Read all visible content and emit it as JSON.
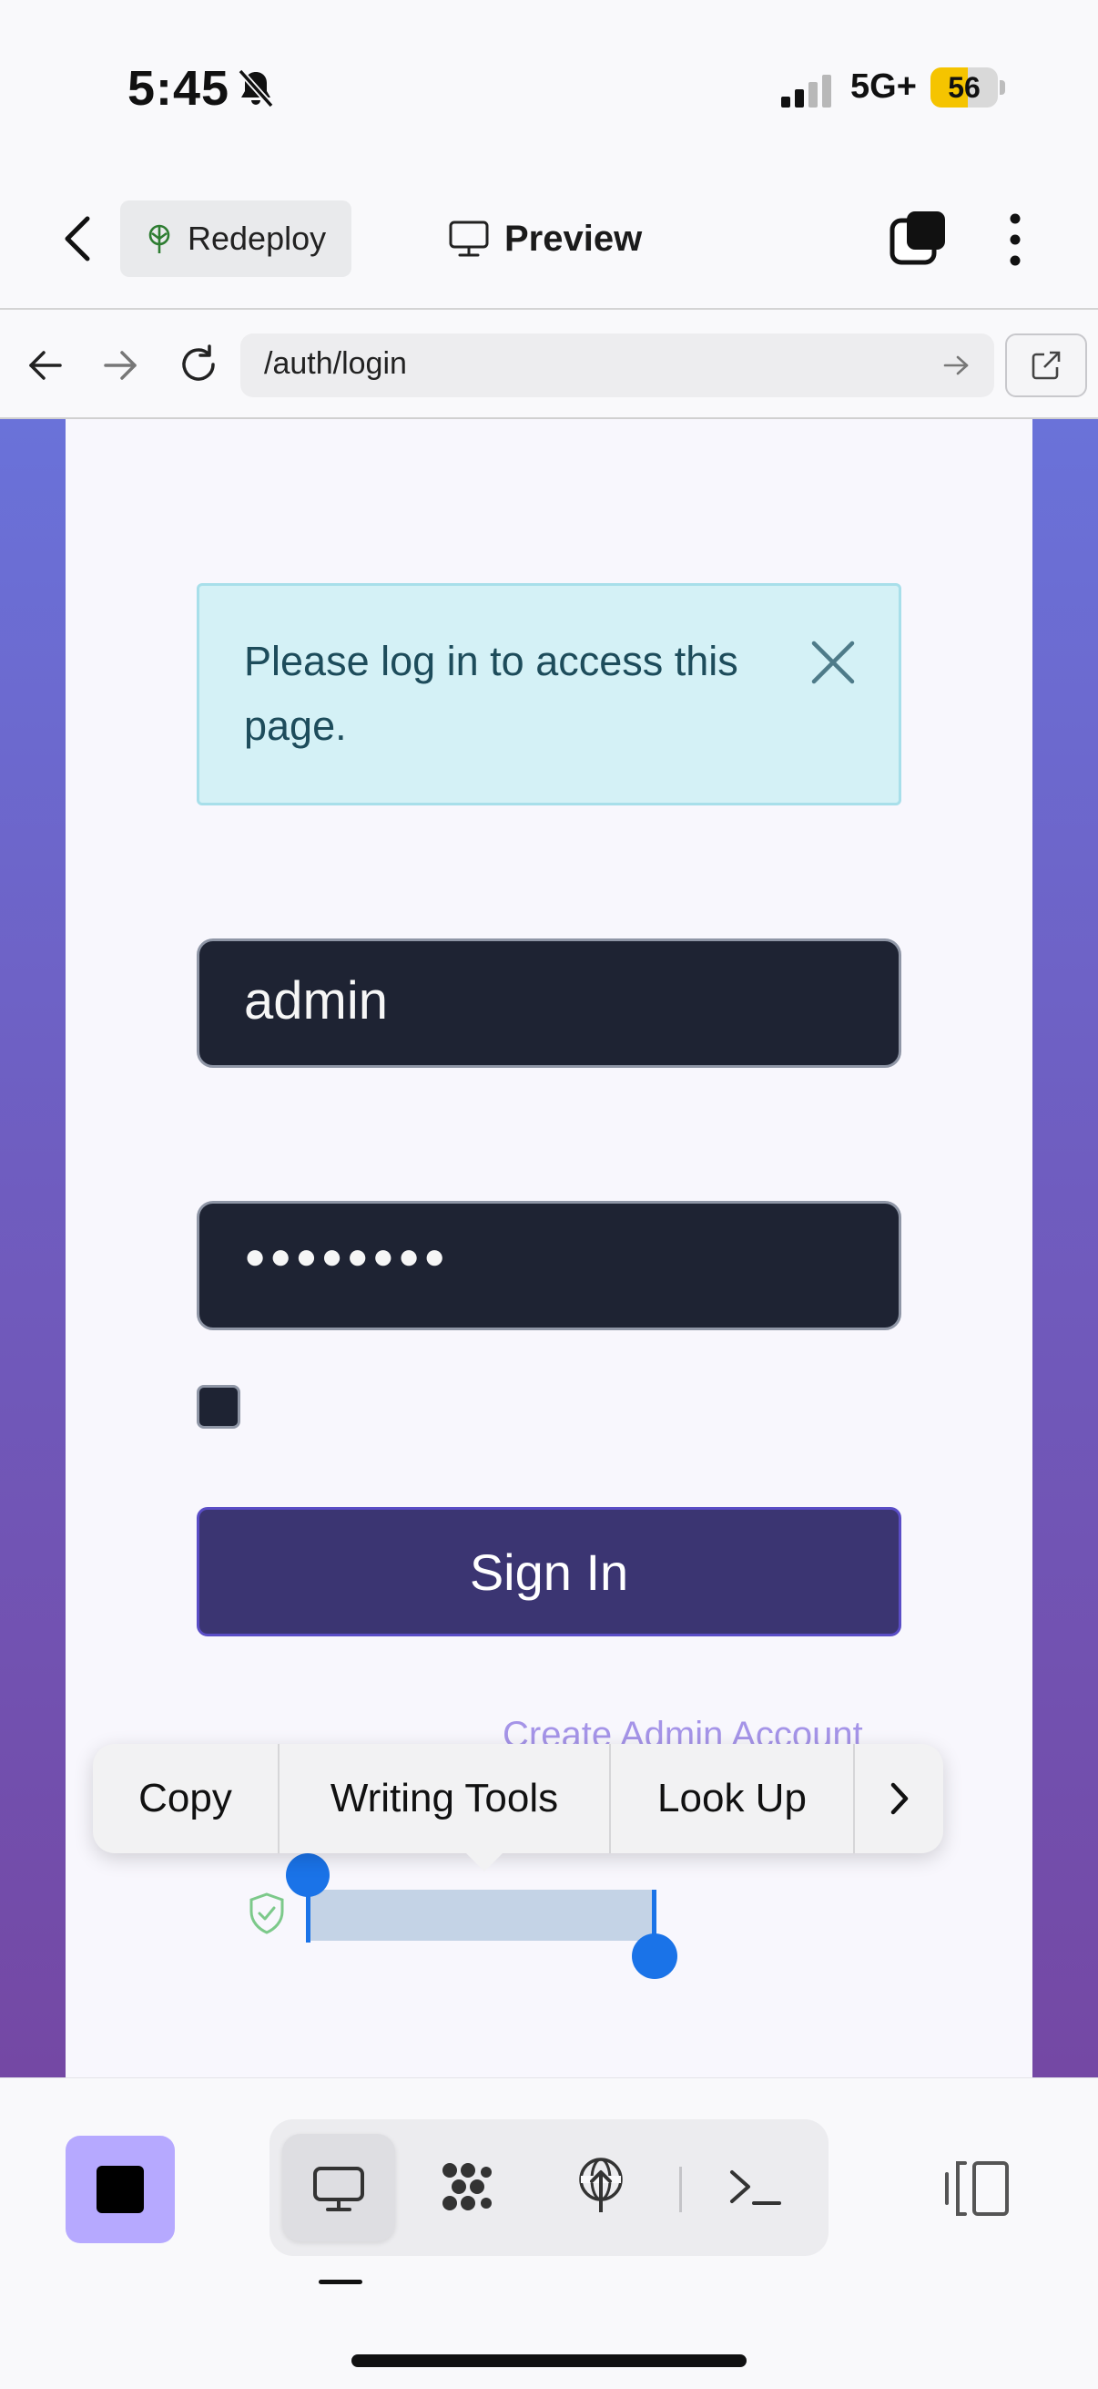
{
  "status_bar": {
    "time": "5:45",
    "network": "5G+",
    "battery": "56",
    "battery_level": 0.56,
    "icons": [
      "bell-slash-icon",
      "signal-icon",
      "battery-icon"
    ]
  },
  "header": {
    "back_icon": "chevron-left-icon",
    "redeploy_label": "Redeploy",
    "preview_label": "Preview",
    "icons": [
      "tree-deploy-icon",
      "monitor-icon",
      "layers-icon",
      "more-vertical-icon"
    ]
  },
  "browser": {
    "url": "/auth/login",
    "icons": [
      "arrow-left-icon",
      "arrow-right-icon",
      "reload-icon",
      "go-arrow-icon",
      "external-link-icon"
    ]
  },
  "login": {
    "alert_text": "Please log in to access this page.",
    "username_value": "admin",
    "password_mask": "●●●●●●●●",
    "signin_label": "Sign In",
    "create_account_link": "Create Admin Account"
  },
  "context_menu": {
    "items": [
      "Copy",
      "Writing Tools",
      "Look Up"
    ],
    "more_glyph": "›"
  },
  "bottom_bar": {
    "icons": [
      "stop-icon",
      "desktop-icon",
      "dots-grid-icon",
      "deploy-icon",
      "terminal-icon",
      "split-view-icon"
    ]
  },
  "colors": {
    "accent": "#1a73e8",
    "button_bg": "#3b3572",
    "alert_bg": "#d4f1f6",
    "stop_bg": "#b6a9ff",
    "battery": "#f5c400"
  }
}
